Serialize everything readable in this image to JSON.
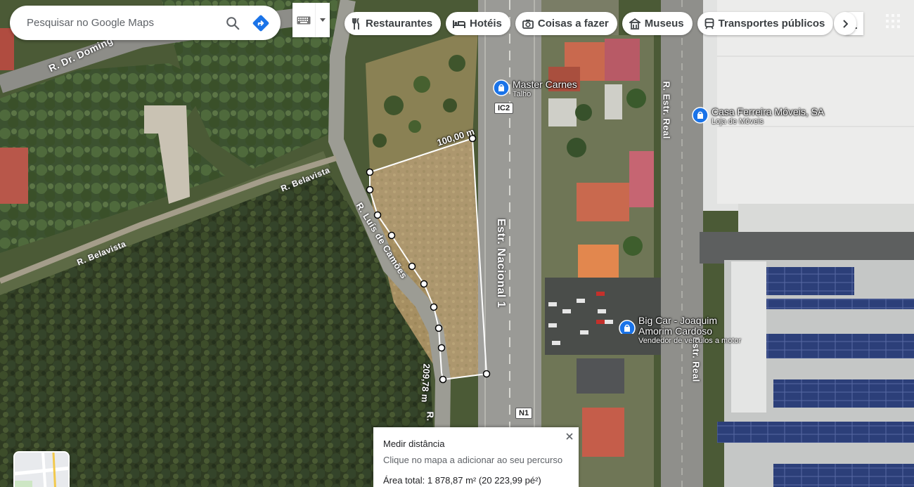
{
  "search": {
    "placeholder": "Pesquisar no Google Maps"
  },
  "chips": [
    {
      "label": "Restaurantes",
      "icon": "fork-knife-icon"
    },
    {
      "label": "Hotéis",
      "icon": "bed-icon"
    },
    {
      "label": "Coisas a fazer",
      "icon": "camera-icon"
    },
    {
      "label": "Museus",
      "icon": "museum-icon"
    },
    {
      "label": "Transportes públicos",
      "icon": "transit-icon"
    }
  ],
  "places": [
    {
      "name": "Master Carnes",
      "category": "Talho"
    },
    {
      "name": "Casa Ferreira Móveis, SA",
      "category": "Loja de Móveis"
    },
    {
      "name_line1": "Big Car - Joaquim",
      "name_line2": "Amorim Cardoso",
      "category": "Vendedor de veículos a motor"
    }
  ],
  "shields": {
    "ic2": "IC2",
    "n1": "N1"
  },
  "streets": {
    "domingos": "R. Dr. Doming",
    "belavista1": "R. Belavista",
    "belavista2": "R. Belavista",
    "camoes": "R. Luís de Camões",
    "nacional": "Estr. Nacional 1",
    "real1": "R. Estr. Real",
    "real2": "Estr. Real",
    "bottom_left": "R."
  },
  "measure_labels": {
    "seg1": "100,00 m",
    "seg2": "209,78 m"
  },
  "measure_panel": {
    "title": "Medir distância",
    "hint": "Clique no mapa a adicionar ao seu percurso",
    "area": "Área total: 1 878,87 m² (20 223,99 pé²)"
  },
  "colors": {
    "accent": "#1a73e8",
    "pin": "#1a73e8",
    "measure_line": "#ffffff"
  }
}
